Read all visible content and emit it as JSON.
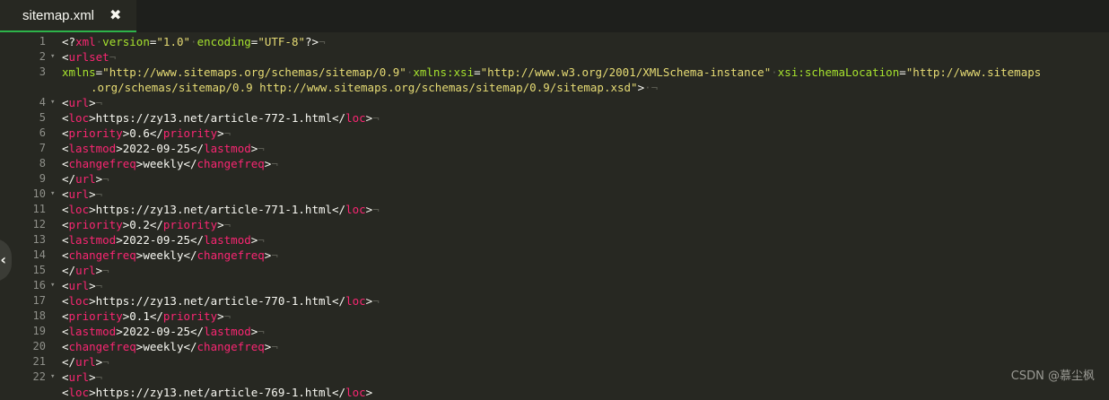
{
  "tab": {
    "title": "sitemap.xml",
    "close_icon": "✖"
  },
  "side_handle": {
    "icon": "‹"
  },
  "watermark": "CSDN @慕尘枫",
  "colors": {
    "tag": "#f92672",
    "attr": "#a6e22e",
    "string": "#e6db74",
    "text": "#f8f8f2",
    "tab_underline": "#2db34a"
  },
  "lines": [
    {
      "num": "1",
      "fold": false,
      "segs": [
        {
          "c": "p",
          "t": "<?"
        },
        {
          "c": "t",
          "t": "xml"
        },
        {
          "c": "ws",
          "t": "·"
        },
        {
          "c": "a",
          "t": "version"
        },
        {
          "c": "p",
          "t": "="
        },
        {
          "c": "s",
          "t": "\"1.0\""
        },
        {
          "c": "ws",
          "t": "·"
        },
        {
          "c": "a",
          "t": "encoding"
        },
        {
          "c": "p",
          "t": "="
        },
        {
          "c": "s",
          "t": "\"UTF-8\""
        },
        {
          "c": "p",
          "t": "?>"
        },
        {
          "c": "ws",
          "t": "¬"
        }
      ]
    },
    {
      "num": "2",
      "fold": true,
      "segs": [
        {
          "c": "p",
          "t": "<"
        },
        {
          "c": "t",
          "t": "urlset"
        },
        {
          "c": "ws",
          "t": "¬"
        }
      ]
    },
    {
      "num": "3",
      "fold": false,
      "segs": [
        {
          "c": "a",
          "t": "xmlns"
        },
        {
          "c": "p",
          "t": "="
        },
        {
          "c": "s",
          "t": "\"http://www.sitemaps.org/schemas/sitemap/0.9\""
        },
        {
          "c": "ws",
          "t": "·"
        },
        {
          "c": "a",
          "t": "xmlns:xsi"
        },
        {
          "c": "p",
          "t": "="
        },
        {
          "c": "s",
          "t": "\"http://www.w3.org/2001/XMLSchema-instance\""
        },
        {
          "c": "ws",
          "t": "·"
        },
        {
          "c": "a",
          "t": "xsi:schemaLocation"
        },
        {
          "c": "p",
          "t": "="
        },
        {
          "c": "s",
          "t": "\"http://www.sitemaps"
        }
      ]
    },
    {
      "num": "",
      "fold": false,
      "wrap": true,
      "segs": [
        {
          "c": "s",
          "t": ".org/schemas/sitemap/0.9 http://www.sitemaps.org/schemas/sitemap/0.9/sitemap.xsd\""
        },
        {
          "c": "p",
          "t": ">"
        },
        {
          "c": "ws",
          "t": "·¬"
        }
      ]
    },
    {
      "num": "4",
      "fold": true,
      "segs": [
        {
          "c": "p",
          "t": "<"
        },
        {
          "c": "t",
          "t": "url"
        },
        {
          "c": "p",
          "t": ">"
        },
        {
          "c": "ws",
          "t": "¬"
        }
      ]
    },
    {
      "num": "5",
      "fold": false,
      "segs": [
        {
          "c": "p",
          "t": "<"
        },
        {
          "c": "t",
          "t": "loc"
        },
        {
          "c": "p",
          "t": ">https://zy13.net/article-772-1.html</"
        },
        {
          "c": "t",
          "t": "loc"
        },
        {
          "c": "p",
          "t": ">"
        },
        {
          "c": "ws",
          "t": "¬"
        }
      ]
    },
    {
      "num": "6",
      "fold": false,
      "segs": [
        {
          "c": "p",
          "t": "<"
        },
        {
          "c": "t",
          "t": "priority"
        },
        {
          "c": "p",
          "t": ">0.6</"
        },
        {
          "c": "t",
          "t": "priority"
        },
        {
          "c": "p",
          "t": ">"
        },
        {
          "c": "ws",
          "t": "¬"
        }
      ]
    },
    {
      "num": "7",
      "fold": false,
      "segs": [
        {
          "c": "p",
          "t": "<"
        },
        {
          "c": "t",
          "t": "lastmod"
        },
        {
          "c": "p",
          "t": ">2022-09-25</"
        },
        {
          "c": "t",
          "t": "lastmod"
        },
        {
          "c": "p",
          "t": ">"
        },
        {
          "c": "ws",
          "t": "¬"
        }
      ]
    },
    {
      "num": "8",
      "fold": false,
      "segs": [
        {
          "c": "p",
          "t": "<"
        },
        {
          "c": "t",
          "t": "changefreq"
        },
        {
          "c": "p",
          "t": ">weekly</"
        },
        {
          "c": "t",
          "t": "changefreq"
        },
        {
          "c": "p",
          "t": ">"
        },
        {
          "c": "ws",
          "t": "¬"
        }
      ]
    },
    {
      "num": "9",
      "fold": false,
      "segs": [
        {
          "c": "p",
          "t": "</"
        },
        {
          "c": "t",
          "t": "url"
        },
        {
          "c": "p",
          "t": ">"
        },
        {
          "c": "ws",
          "t": "¬"
        }
      ]
    },
    {
      "num": "10",
      "fold": true,
      "segs": [
        {
          "c": "p",
          "t": "<"
        },
        {
          "c": "t",
          "t": "url"
        },
        {
          "c": "p",
          "t": ">"
        },
        {
          "c": "ws",
          "t": "¬"
        }
      ]
    },
    {
      "num": "11",
      "fold": false,
      "segs": [
        {
          "c": "p",
          "t": "<"
        },
        {
          "c": "t",
          "t": "loc"
        },
        {
          "c": "p",
          "t": ">https://zy13.net/article-771-1.html</"
        },
        {
          "c": "t",
          "t": "loc"
        },
        {
          "c": "p",
          "t": ">"
        },
        {
          "c": "ws",
          "t": "¬"
        }
      ]
    },
    {
      "num": "12",
      "fold": false,
      "segs": [
        {
          "c": "p",
          "t": "<"
        },
        {
          "c": "t",
          "t": "priority"
        },
        {
          "c": "p",
          "t": ">0.2</"
        },
        {
          "c": "t",
          "t": "priority"
        },
        {
          "c": "p",
          "t": ">"
        },
        {
          "c": "ws",
          "t": "¬"
        }
      ]
    },
    {
      "num": "13",
      "fold": false,
      "segs": [
        {
          "c": "p",
          "t": "<"
        },
        {
          "c": "t",
          "t": "lastmod"
        },
        {
          "c": "p",
          "t": ">2022-09-25</"
        },
        {
          "c": "t",
          "t": "lastmod"
        },
        {
          "c": "p",
          "t": ">"
        },
        {
          "c": "ws",
          "t": "¬"
        }
      ]
    },
    {
      "num": "14",
      "fold": false,
      "segs": [
        {
          "c": "p",
          "t": "<"
        },
        {
          "c": "t",
          "t": "changefreq"
        },
        {
          "c": "p",
          "t": ">weekly</"
        },
        {
          "c": "t",
          "t": "changefreq"
        },
        {
          "c": "p",
          "t": ">"
        },
        {
          "c": "ws",
          "t": "¬"
        }
      ]
    },
    {
      "num": "15",
      "fold": false,
      "segs": [
        {
          "c": "p",
          "t": "</"
        },
        {
          "c": "t",
          "t": "url"
        },
        {
          "c": "p",
          "t": ">"
        },
        {
          "c": "ws",
          "t": "¬"
        }
      ]
    },
    {
      "num": "16",
      "fold": true,
      "segs": [
        {
          "c": "p",
          "t": "<"
        },
        {
          "c": "t",
          "t": "url"
        },
        {
          "c": "p",
          "t": ">"
        },
        {
          "c": "ws",
          "t": "¬"
        }
      ]
    },
    {
      "num": "17",
      "fold": false,
      "segs": [
        {
          "c": "p",
          "t": "<"
        },
        {
          "c": "t",
          "t": "loc"
        },
        {
          "c": "p",
          "t": ">https://zy13.net/article-770-1.html</"
        },
        {
          "c": "t",
          "t": "loc"
        },
        {
          "c": "p",
          "t": ">"
        },
        {
          "c": "ws",
          "t": "¬"
        }
      ]
    },
    {
      "num": "18",
      "fold": false,
      "segs": [
        {
          "c": "p",
          "t": "<"
        },
        {
          "c": "t",
          "t": "priority"
        },
        {
          "c": "p",
          "t": ">0.1</"
        },
        {
          "c": "t",
          "t": "priority"
        },
        {
          "c": "p",
          "t": ">"
        },
        {
          "c": "ws",
          "t": "¬"
        }
      ]
    },
    {
      "num": "19",
      "fold": false,
      "segs": [
        {
          "c": "p",
          "t": "<"
        },
        {
          "c": "t",
          "t": "lastmod"
        },
        {
          "c": "p",
          "t": ">2022-09-25</"
        },
        {
          "c": "t",
          "t": "lastmod"
        },
        {
          "c": "p",
          "t": ">"
        },
        {
          "c": "ws",
          "t": "¬"
        }
      ]
    },
    {
      "num": "20",
      "fold": false,
      "segs": [
        {
          "c": "p",
          "t": "<"
        },
        {
          "c": "t",
          "t": "changefreq"
        },
        {
          "c": "p",
          "t": ">weekly</"
        },
        {
          "c": "t",
          "t": "changefreq"
        },
        {
          "c": "p",
          "t": ">"
        },
        {
          "c": "ws",
          "t": "¬"
        }
      ]
    },
    {
      "num": "21",
      "fold": false,
      "segs": [
        {
          "c": "p",
          "t": "</"
        },
        {
          "c": "t",
          "t": "url"
        },
        {
          "c": "p",
          "t": ">"
        },
        {
          "c": "ws",
          "t": "¬"
        }
      ]
    },
    {
      "num": "22",
      "fold": true,
      "segs": [
        {
          "c": "p",
          "t": "<"
        },
        {
          "c": "t",
          "t": "url"
        },
        {
          "c": "p",
          "t": ">"
        },
        {
          "c": "ws",
          "t": "¬"
        }
      ]
    },
    {
      "num": "",
      "fold": false,
      "segs": [
        {
          "c": "p",
          "t": "<"
        },
        {
          "c": "t",
          "t": "loc"
        },
        {
          "c": "p",
          "t": ">https://zy13.net/article-769-1.html</"
        },
        {
          "c": "t",
          "t": "loc"
        },
        {
          "c": "p",
          "t": ">"
        }
      ]
    }
  ]
}
